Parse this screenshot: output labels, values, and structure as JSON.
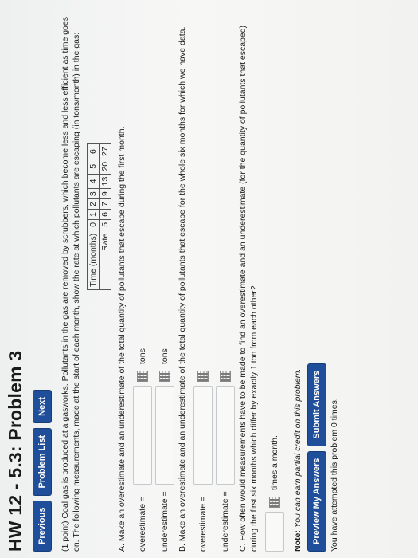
{
  "title": "HW 12 - 5.3: Problem 3",
  "nav": {
    "previous": "Previous",
    "problem_list": "Problem List",
    "next": "Next"
  },
  "intro": "(1 point) Coal gas is produced at a gasworks. Pollutants in the gas are removed by scrubbers, which become less and less efficient as time goes on. The following measurements, made at the start of each month, show the rate at which pollutants are escaping (in tons/month) in the gas:",
  "table": {
    "row1_label": "Time (months)",
    "row1": [
      "0",
      "1",
      "2",
      "3",
      "4",
      "5",
      "6"
    ],
    "row2_label": "Rate",
    "row2": [
      "5",
      "6",
      "7",
      "9",
      "13",
      "20",
      "27"
    ]
  },
  "part_a": {
    "text": "A. Make an overestimate and an underestimate of the total quantity of pollutants that escape during the first month.",
    "over_label": "overestimate =",
    "under_label": "underestimate =",
    "unit": "tons"
  },
  "part_b": {
    "text": "B. Make an overestimate and an underestimate of the total quantity of pollutants that escape for the whole six months for which we have data.",
    "over_label": "overestimate =",
    "under_label": "underestimate ="
  },
  "part_c": {
    "text": "C. How often would measurements have to be made to find an overestimate and an underestimate (for the quantity of pollutants that escaped) during the first six months which differ by exactly 1 ton from each other?",
    "unit": "times a month."
  },
  "note": {
    "label": "Note:",
    "text": "You can earn partial credit on this problem."
  },
  "buttons": {
    "preview": "Preview My Answers",
    "submit": "Submit Answers"
  },
  "attempts": "You have attempted this problem 0 times."
}
